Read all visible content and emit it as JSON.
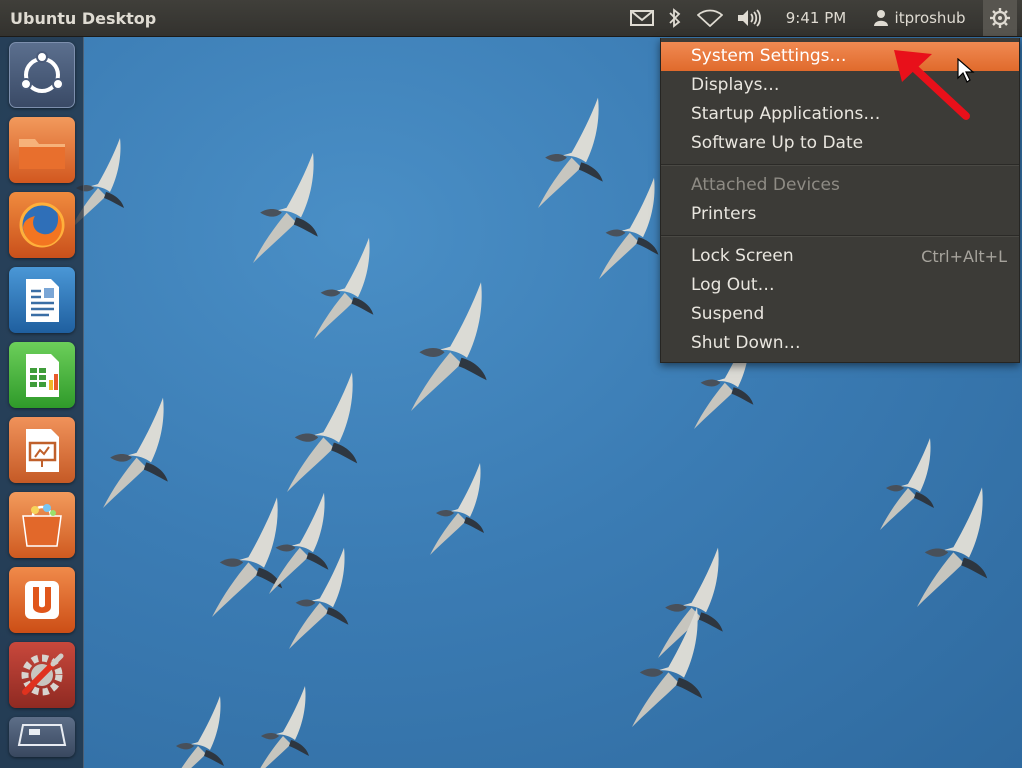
{
  "top_panel": {
    "title": "Ubuntu Desktop",
    "clock": "9:41 PM",
    "user": "itproshub",
    "indicators": [
      "mail-icon",
      "bluetooth-icon",
      "wifi-icon",
      "volume-icon",
      "gear-icon"
    ]
  },
  "launcher": {
    "items": [
      {
        "icon": "dash-home-icon"
      },
      {
        "icon": "files-folder-icon"
      },
      {
        "icon": "firefox-icon"
      },
      {
        "icon": "libreoffice-writer-icon"
      },
      {
        "icon": "libreoffice-calc-icon"
      },
      {
        "icon": "libreoffice-impress-icon"
      },
      {
        "icon": "software-center-icon"
      },
      {
        "icon": "ubuntu-one-icon"
      },
      {
        "icon": "system-settings-icon"
      },
      {
        "icon": "workspace-switcher-icon"
      }
    ]
  },
  "session_menu": {
    "items": {
      "system_settings": "System Settings…",
      "displays": "Displays…",
      "startup_applications": "Startup Applications…",
      "software_up_to_date": "Software Up to Date",
      "attached_devices": "Attached Devices",
      "printers": "Printers",
      "lock_screen": "Lock Screen",
      "lock_screen_shortcut": "Ctrl+Alt+L",
      "log_out": "Log Out…",
      "suspend": "Suspend",
      "shut_down": "Shut Down…"
    },
    "highlighted": "system_settings"
  },
  "colors": {
    "panel": "#3c3b37",
    "highlight": "#e9743a",
    "desktop": "#3b7cb4",
    "arrow": "#e8101a"
  }
}
